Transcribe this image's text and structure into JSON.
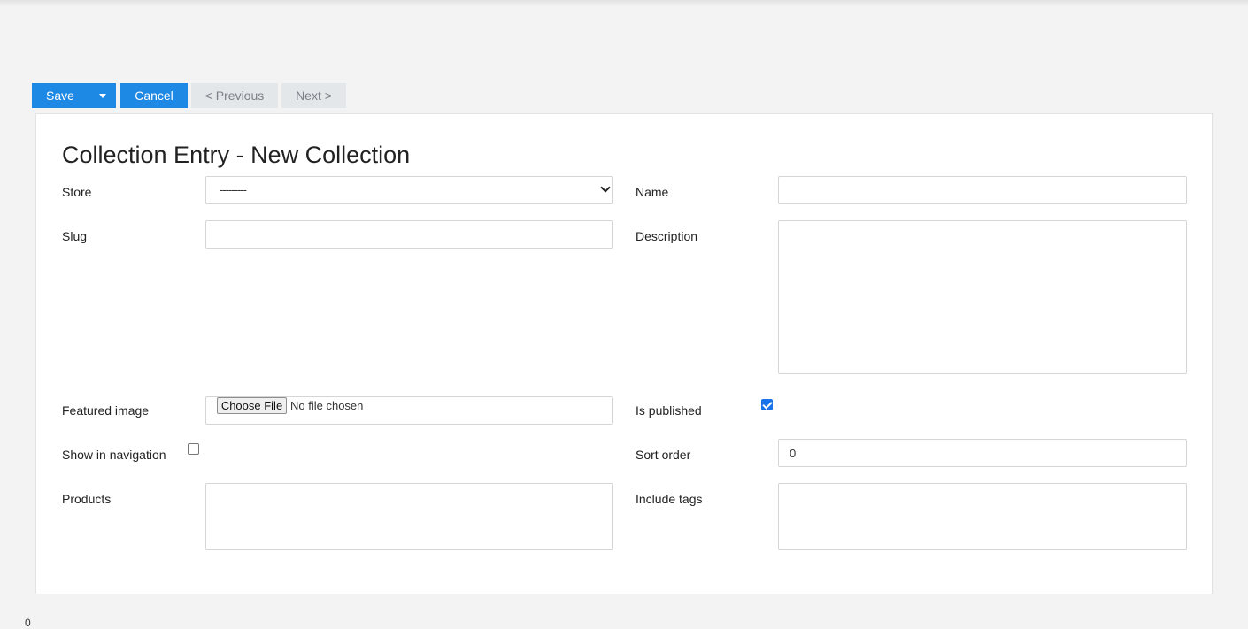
{
  "toolbar": {
    "save_label": "Save",
    "cancel_label": "Cancel",
    "previous_label": "< Previous",
    "next_label": "Next >"
  },
  "form": {
    "title": "Collection Entry - New Collection",
    "store": {
      "label": "Store",
      "selected": "---------"
    },
    "name": {
      "label": "Name",
      "value": ""
    },
    "slug": {
      "label": "Slug",
      "value": ""
    },
    "description": {
      "label": "Description",
      "value": ""
    },
    "featured_image": {
      "label": "Featured image",
      "button_label": "Choose File",
      "status": "No file chosen"
    },
    "is_published": {
      "label": "Is published",
      "checked": true
    },
    "show_in_navigation": {
      "label": "Show in navigation",
      "checked": false
    },
    "sort_order": {
      "label": "Sort order",
      "value": "0"
    },
    "products": {
      "label": "Products"
    },
    "include_tags": {
      "label": "Include tags"
    }
  },
  "footer": {
    "text": "0"
  },
  "colors": {
    "primary": "#1e88e5",
    "disabled_button": "#e4e7ea",
    "page_background": "#f3f3f3"
  }
}
